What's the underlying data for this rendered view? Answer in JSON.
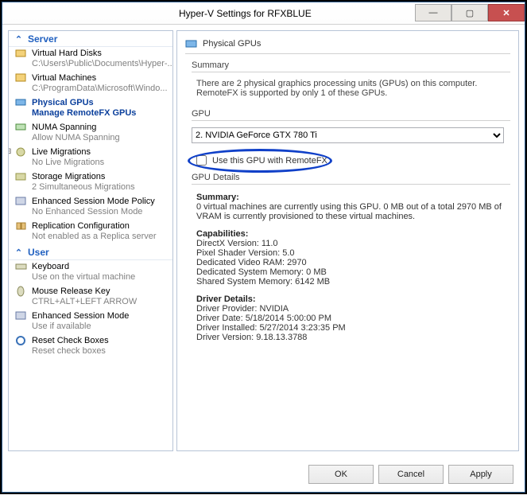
{
  "window": {
    "title": "Hyper-V Settings for RFXBLUE"
  },
  "groups": {
    "server": "Server",
    "user": "User"
  },
  "nav": {
    "vhd": {
      "label": "Virtual Hard Disks",
      "sub": "C:\\Users\\Public\\Documents\\Hyper-..."
    },
    "vm": {
      "label": "Virtual Machines",
      "sub": "C:\\ProgramData\\Microsoft\\Windo..."
    },
    "pgpu": {
      "label": "Physical GPUs",
      "sub": "Manage RemoteFX GPUs"
    },
    "numa": {
      "label": "NUMA Spanning",
      "sub": "Allow NUMA Spanning"
    },
    "live": {
      "label": "Live Migrations",
      "sub": "No Live Migrations"
    },
    "storage": {
      "label": "Storage Migrations",
      "sub": "2 Simultaneous Migrations"
    },
    "esmp": {
      "label": "Enhanced Session Mode Policy",
      "sub": "No Enhanced Session Mode"
    },
    "repl": {
      "label": "Replication Configuration",
      "sub": "Not enabled as a Replica server"
    },
    "kbd": {
      "label": "Keyboard",
      "sub": "Use on the virtual machine"
    },
    "mrk": {
      "label": "Mouse Release Key",
      "sub": "CTRL+ALT+LEFT ARROW"
    },
    "esm": {
      "label": "Enhanced Session Mode",
      "sub": "Use if available"
    },
    "rcb": {
      "label": "Reset Check Boxes",
      "sub": "Reset check boxes"
    }
  },
  "details": {
    "panel_title": "Physical GPUs",
    "summary_hdr": "Summary",
    "summary_txt": "There are 2 physical graphics processing units (GPUs) on this computer. RemoteFX is supported by only 1 of these GPUs.",
    "gpu_hdr": "GPU",
    "gpu_selected": "2. NVIDIA GeForce GTX 780 Ti",
    "checkbox_label": "Use this GPU with RemoteFX",
    "gpu_details_hdr": "GPU Details",
    "sum2_hdr": "Summary:",
    "sum2_txt": "0 virtual machines are currently using this GPU. 0 MB out of a total 2970 MB of VRAM is currently provisioned to these virtual machines.",
    "caps_hdr": "Capabilities:",
    "caps": {
      "dx": "DirectX Version: 11.0",
      "ps": "Pixel Shader Version: 5.0",
      "vram": "Dedicated Video RAM: 2970",
      "dsm": "Dedicated System Memory: 0 MB",
      "ssm": "Shared System Memory: 6142 MB"
    },
    "drv_hdr": "Driver Details:",
    "drv": {
      "prov": "Driver Provider: NVIDIA",
      "date": "Driver Date: 5/18/2014 5:00:00 PM",
      "inst": "Driver Installed: 5/27/2014 3:23:35 PM",
      "ver": "Driver Version: 9.18.13.3788"
    }
  },
  "buttons": {
    "ok": "OK",
    "cancel": "Cancel",
    "apply": "Apply"
  }
}
